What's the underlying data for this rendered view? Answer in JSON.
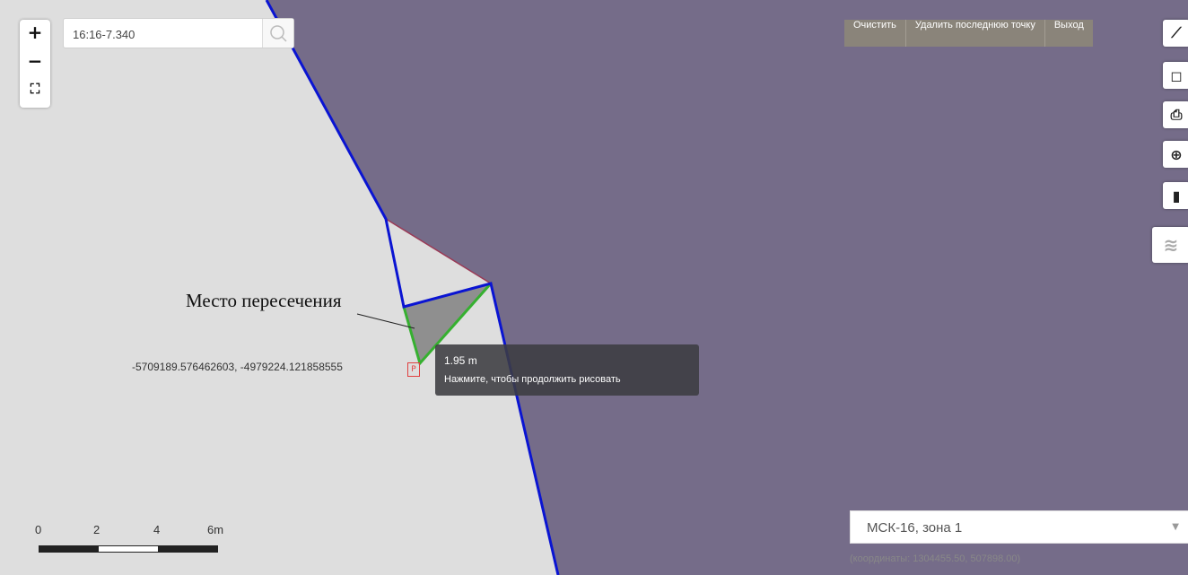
{
  "colors": {
    "land": "#dedede",
    "parcel": "#756c89",
    "boundary": "#0a14d2",
    "measure_line": "#36b030",
    "guide_line": "#9a3a56",
    "overlap_fill": "#8f8f8f"
  },
  "zoom": {
    "in_label": "+",
    "out_label": "−",
    "fit_label": "⛶"
  },
  "search": {
    "value": "16:16-7.340",
    "icon": "search-icon"
  },
  "draw_toolbar": {
    "clear_label": "Очистить",
    "undo_label": "Удалить последнюю точку",
    "exit_label": "Выход"
  },
  "tools": [
    {
      "icon": "ruler-icon",
      "glyph": "⟋"
    },
    {
      "icon": "area-icon",
      "glyph": "◻"
    },
    {
      "icon": "print-icon",
      "glyph": "⎙"
    },
    {
      "icon": "crosshair-icon",
      "glyph": "⊕"
    },
    {
      "icon": "chart-icon",
      "glyph": "▮"
    },
    {
      "icon": "layers-icon",
      "glyph": "≋"
    }
  ],
  "tooltip": {
    "distance": "1.95 m",
    "hint": "Нажмите, чтобы продолжить рисовать"
  },
  "cursor_coords": "-5709189.576462603, -4979224.121858555",
  "annotation": "Место пересечения",
  "scale": {
    "labels": [
      "0",
      "2",
      "4",
      "6m"
    ]
  },
  "projection": {
    "selected": "МСК-16, зона 1"
  },
  "coordinates_readout": "(координаты: 1304455.50, 507898.00)"
}
